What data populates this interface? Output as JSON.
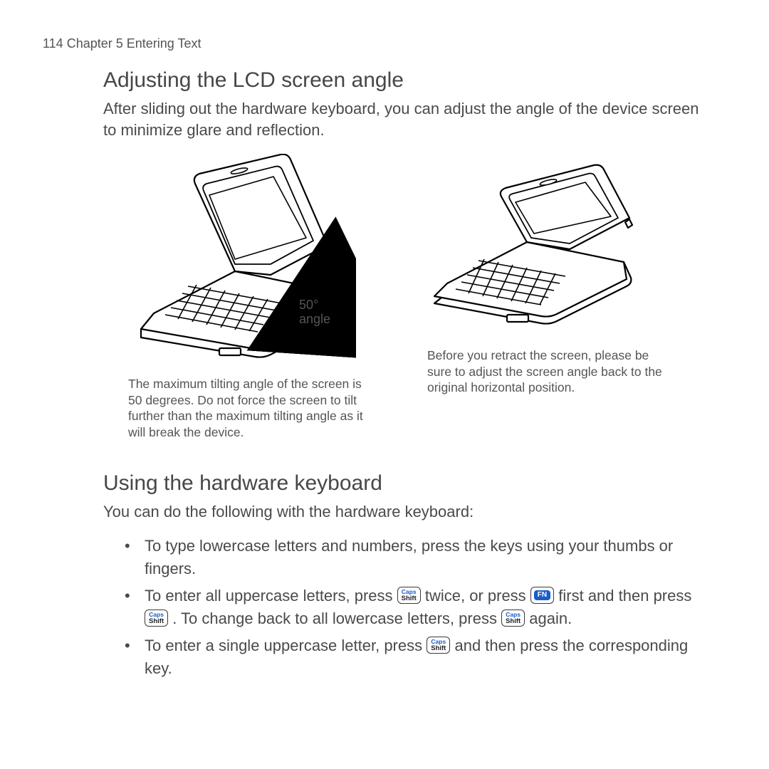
{
  "header": "114  Chapter 5  Entering Text",
  "section1": {
    "title": "Adjusting the LCD screen angle",
    "intro": "After sliding out the hardware keyboard, you can adjust the angle of the device screen to minimize glare and reflection.",
    "angle_label1": "50°",
    "angle_label2": "angle",
    "caption1": "The maximum tilting angle of the screen is 50 degrees. Do not force the screen to tilt further than the maximum tilting angle as it will break the device.",
    "caption2": "Before you retract the screen, please be sure to adjust the screen angle back to the original horizontal position."
  },
  "section2": {
    "title": "Using the hardware keyboard",
    "intro": "You can do the following with the hardware keyboard:",
    "bullet1": "To type lowercase letters and numbers, press the keys using your thumbs or fingers.",
    "b2_a": "To enter all uppercase letters, press ",
    "b2_b": " twice, or press ",
    "b2_c": " first and then press ",
    "b2_d": " . To change back to all lowercase letters, press ",
    "b2_e": " again.",
    "b3_a": "To enter a single uppercase letter, press ",
    "b3_b": " and then press the corresponding key."
  },
  "keys": {
    "caps_top": "Caps",
    "caps_bottom": "Shift",
    "fn": "FN"
  }
}
